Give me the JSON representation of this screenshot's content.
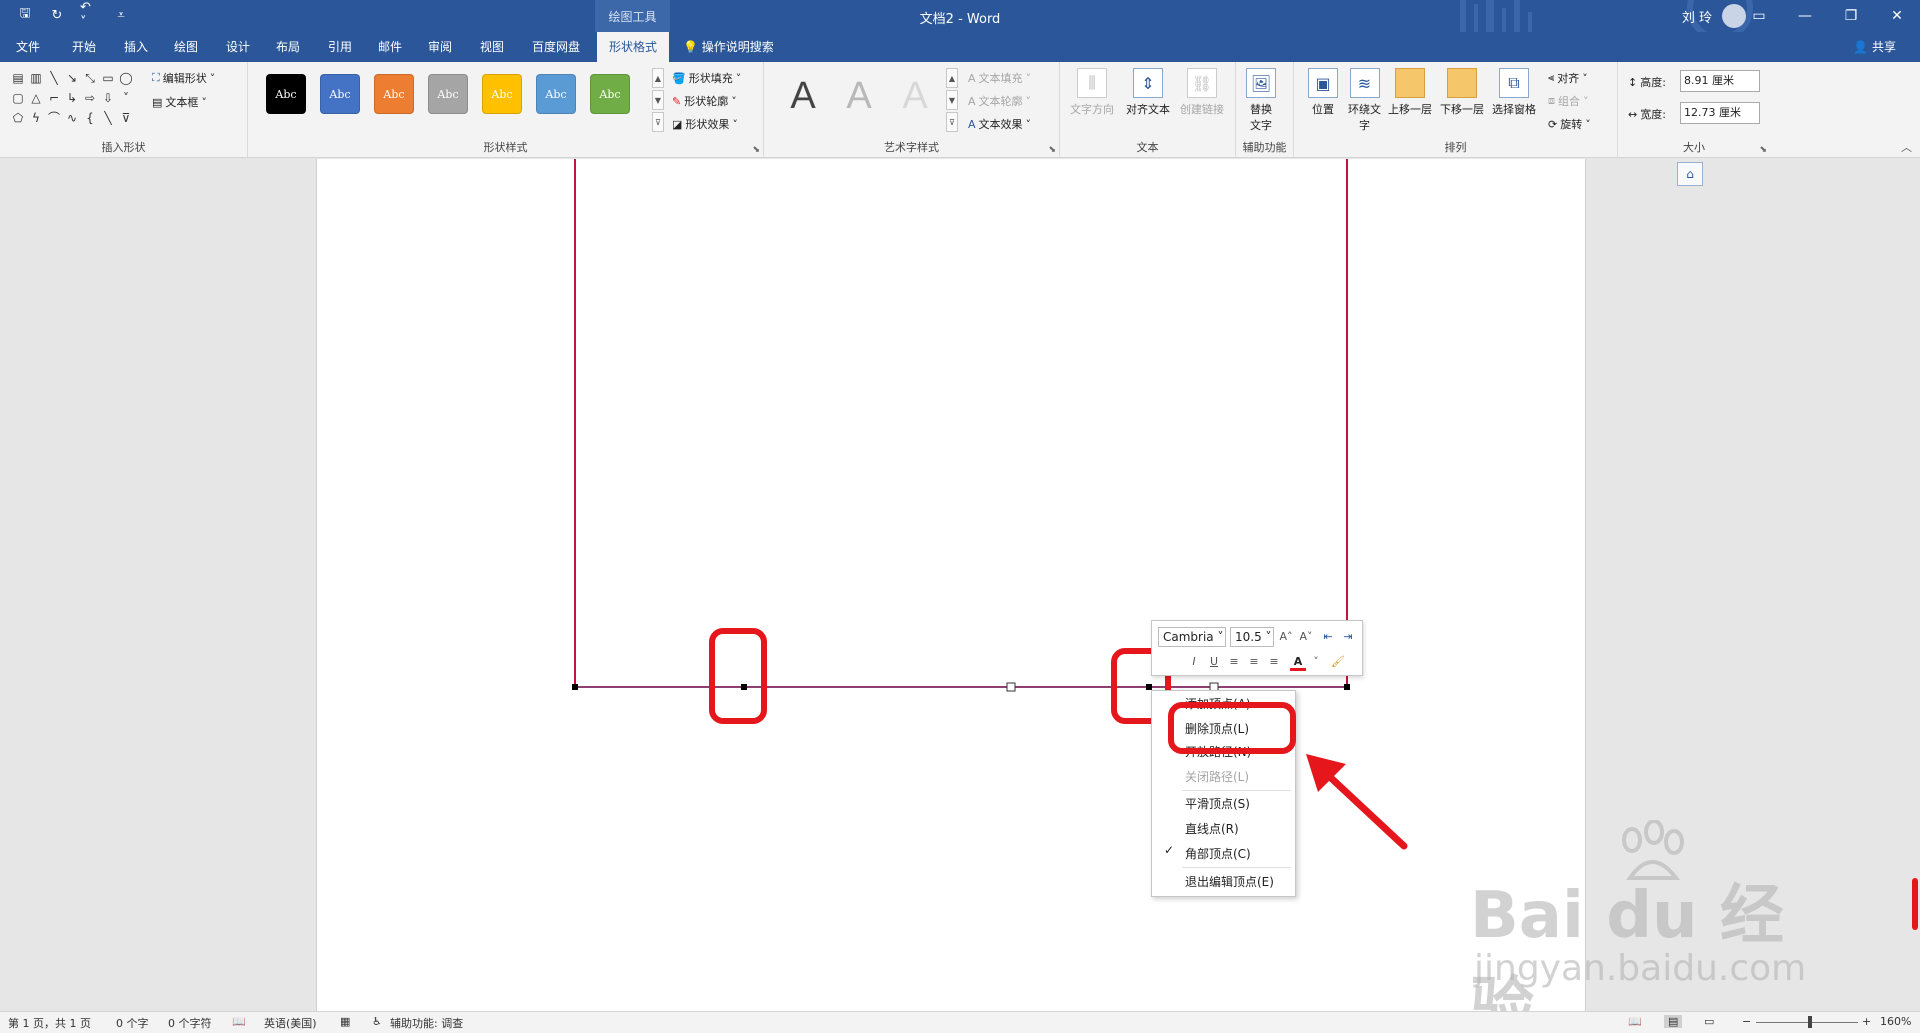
{
  "titlebar": {
    "context_tab_header": "绘图工具",
    "doc_title": "文档2  -  Word",
    "user": "刘 玲",
    "qat": [
      "save-icon",
      "redo-icon",
      "undo-icon",
      "customize-icon"
    ],
    "qat_glyphs": [
      "🖫",
      "↻",
      "↶ ˅",
      "⩡"
    ],
    "win_glyphs": {
      "ribbon_options": "▭",
      "minimize": "—",
      "restore": "❐",
      "close": "✕"
    }
  },
  "menubar": {
    "tabs": [
      "文件",
      "开始",
      "插入",
      "绘图",
      "设计",
      "布局",
      "引用",
      "邮件",
      "审阅",
      "视图",
      "百度网盘",
      "形状格式"
    ],
    "active_tab": "形状格式",
    "tellme": "操作说明搜索",
    "share": "共享"
  },
  "ribbon": {
    "insert_shapes": {
      "label": "插入形状",
      "edit_shape": "编辑形状",
      "text_box": "文本框"
    },
    "shape_styles": {
      "label": "形状样式",
      "swatch_text": "Abc",
      "swatch_colors": [
        "#000000",
        "#4472c4",
        "#ed7d31",
        "#a5a5a5",
        "#ffc000",
        "#5b9bd5",
        "#70ad47"
      ],
      "fill": "形状填充",
      "outline": "形状轮廓",
      "effects": "形状效果"
    },
    "wordart_styles": {
      "label": "艺术字样式",
      "letter": "A",
      "text_fill": "文本填充",
      "text_outline": "文本轮廓",
      "text_effects": "文本效果"
    },
    "text": {
      "label": "文本",
      "direction": "文字方向",
      "align": "对齐文本",
      "link": "创建链接"
    },
    "accessibility": {
      "label": "辅助功能",
      "alt_text": "替换\n文字"
    },
    "arrange": {
      "label": "排列",
      "position": "位置",
      "wrap": "环绕文\n字",
      "bring_forward": "上移一层",
      "send_backward": "下移一层",
      "selection_pane": "选择窗格",
      "align": "对齐",
      "group": "组合",
      "rotate": "旋转"
    },
    "size": {
      "label": "大小",
      "height_label": "高度:",
      "height_value": "8.91 厘米",
      "width_label": "宽度:",
      "width_value": "12.73 厘米"
    }
  },
  "minitoolbar": {
    "font": "Cambria",
    "size": "10.5"
  },
  "context_menu": {
    "items": [
      {
        "label": "添加顶点(A)",
        "enabled": true
      },
      {
        "label": "删除顶点(L)",
        "enabled": true
      },
      {
        "label": "开放路径(N)",
        "enabled": true
      },
      {
        "label": "关闭路径(L)",
        "enabled": false
      },
      {
        "label": "平滑顶点(S)",
        "enabled": true
      },
      {
        "label": "直线点(R)",
        "enabled": true
      },
      {
        "label": "角部顶点(C)",
        "enabled": true,
        "checked": true
      },
      {
        "label": "退出编辑顶点(E)",
        "enabled": true
      }
    ]
  },
  "watermark": {
    "brand": "Bai du 经验",
    "url": "jingyan.baidu.com"
  },
  "statusbar": {
    "page": "第 1 页，共 1 页",
    "words": "0 个字",
    "chars": "0 个字符",
    "language": "英语(美国)",
    "accessibility": "辅助功能: 调查",
    "zoom": "160%"
  },
  "colors": {
    "brand": "#2b579a",
    "highlight": "#e5161c",
    "shape_outline": "#c0143c"
  }
}
